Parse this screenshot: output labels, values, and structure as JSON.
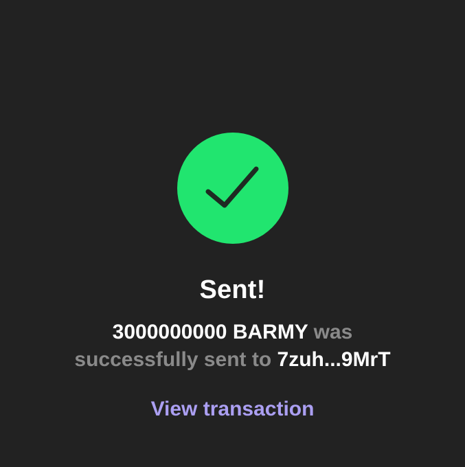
{
  "status": {
    "icon": "checkmark-icon",
    "icon_color": "#21e56f",
    "title": "Sent!"
  },
  "message": {
    "amount": "3000000000 BARMY",
    "text_mid": "was successfully sent to",
    "recipient": "7zuh...9MrT"
  },
  "actions": {
    "view_transaction_label": "View transaction",
    "link_color": "#ab9ff2"
  }
}
